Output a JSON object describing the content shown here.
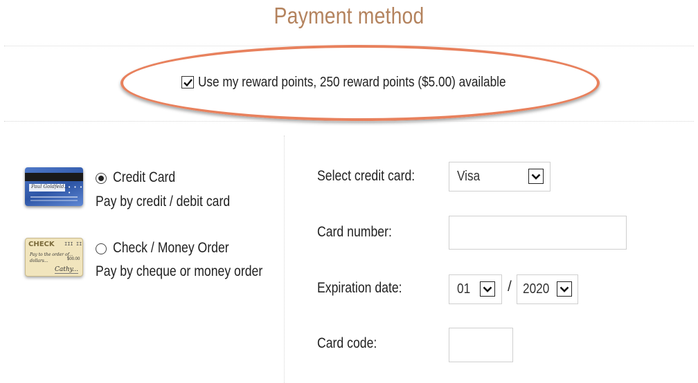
{
  "header": {
    "title": "Payment method"
  },
  "reward": {
    "label": "Use my reward points, 250 reward points ($5.00) available",
    "checked": true,
    "highlight_color": "#e8815d"
  },
  "methods": [
    {
      "label": "Credit Card",
      "description": "Pay by credit / debit card",
      "selected": true,
      "icon": "credit-card-image"
    },
    {
      "label": "Check / Money Order",
      "description": "Pay by cheque or money order",
      "selected": false,
      "icon": "check-image"
    }
  ],
  "form": {
    "card_type_label": "Select credit card:",
    "card_type_value": "Visa",
    "card_number_label": "Card number:",
    "card_number_value": "",
    "expiration_label": "Expiration date:",
    "exp_month": "01",
    "exp_separator": "/",
    "exp_year": "2020",
    "card_code_label": "Card code:",
    "card_code_value": ""
  },
  "images": {
    "credit_card": {
      "signature": "Paul Goldfeld...",
      "code": "• • • •"
    },
    "check": {
      "header": "CHECK",
      "number": "III II",
      "line1": "Pay to the order of...",
      "line2": "dollars...",
      "amount": "$00.00",
      "signature": "Cathy..."
    }
  },
  "colors": {
    "title": "#b4835e",
    "accent": "#e8815d"
  }
}
